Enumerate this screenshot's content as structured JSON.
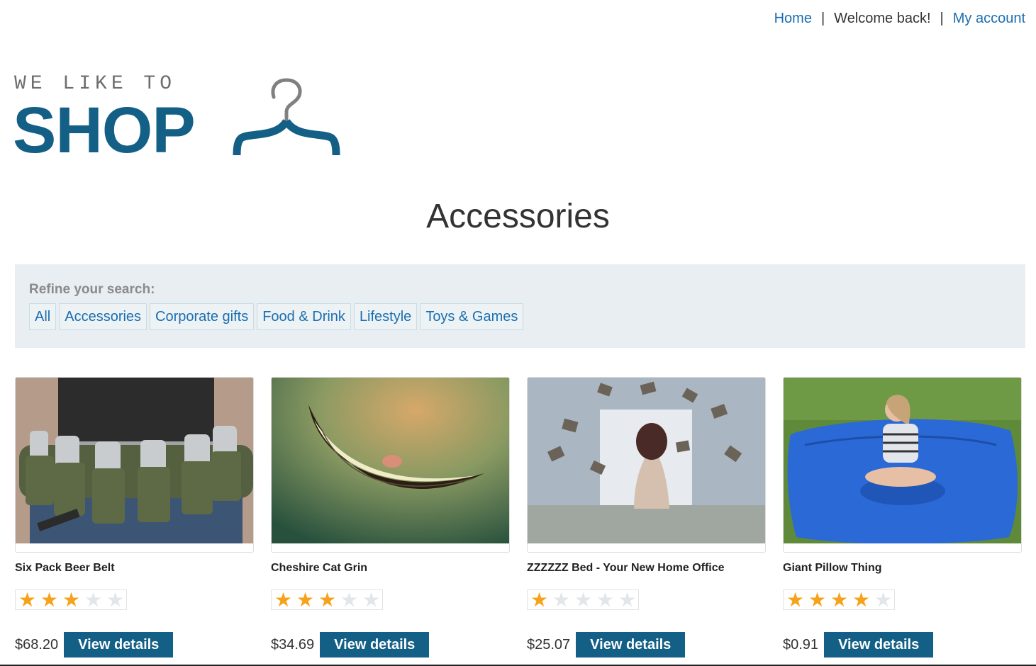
{
  "nav": {
    "home": "Home",
    "sep": "|",
    "welcome": "Welcome back!",
    "account": "My account"
  },
  "logo": {
    "tagline": "WE LIKE TO",
    "word": "SHOP"
  },
  "page": {
    "title": "Accessories"
  },
  "filters": {
    "label": "Refine your search:",
    "items": [
      "All",
      "Accessories",
      "Corporate gifts",
      "Food & Drink",
      "Lifestyle",
      "Toys & Games"
    ]
  },
  "products": [
    {
      "name": "Six Pack Beer Belt",
      "rating": 3,
      "max_rating": 5,
      "price": "$68.20",
      "button": "View details"
    },
    {
      "name": "Cheshire Cat Grin",
      "rating": 3,
      "max_rating": 5,
      "price": "$34.69",
      "button": "View details"
    },
    {
      "name": "ZZZZZZ Bed - Your New Home Office",
      "rating": 1,
      "max_rating": 5,
      "price": "$25.07",
      "button": "View details"
    },
    {
      "name": "Giant Pillow Thing",
      "rating": 4,
      "max_rating": 5,
      "price": "$0.91",
      "button": "View details"
    }
  ],
  "colors": {
    "brand": "#135f85",
    "link": "#1a6eb0",
    "star": "#f7a21b",
    "filter_bg": "#e8eef1"
  }
}
